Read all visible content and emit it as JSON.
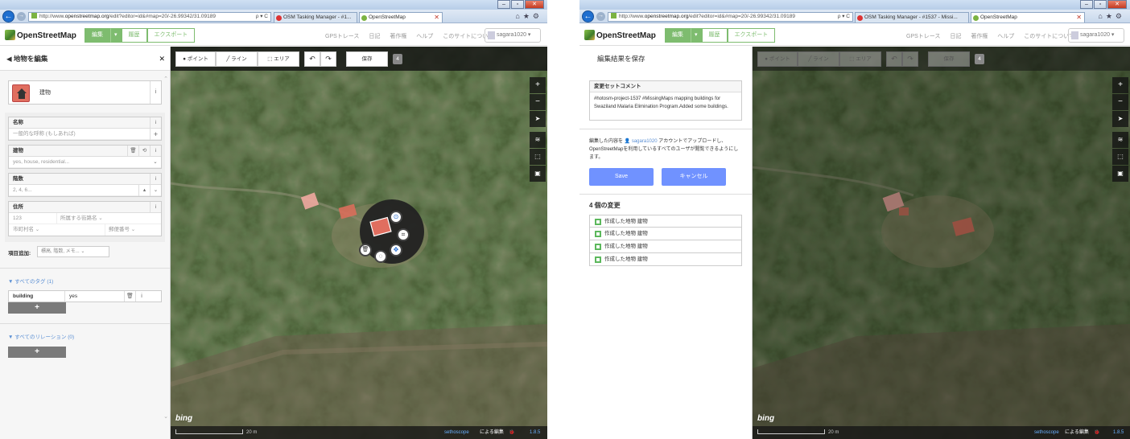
{
  "win1": {
    "address": {
      "pre": "http://www.",
      "host": "openstreetmap.org",
      "post": "/edit?editor=id&#map=20/-26.99342/31.09189",
      "tools": "ρ ▾ C"
    },
    "tabs": [
      {
        "label": "OSM Tasking Manager - #1...",
        "active": false
      },
      {
        "label": "OpenStreetMap",
        "active": true
      }
    ],
    "nav": {
      "logo": "OpenStreetMap",
      "edit": "編集",
      "dd": "▾",
      "history": "履歴",
      "export": "エクスポート",
      "links": [
        "GPSトレース",
        "日記",
        "著作権",
        "ヘルプ",
        "このサイトについて"
      ],
      "user": "sagara1020 ▾"
    },
    "sidebar": {
      "title": "◀  地物を編集",
      "close": "✕",
      "preset": {
        "name": "建物",
        "info": "i"
      },
      "fields": [
        {
          "label": "名称",
          "value": "一般的な呼称 (もしあれば)",
          "icons": [
            "i"
          ],
          "extra": "+"
        },
        {
          "label": "建物",
          "value": "yes, house, residential...",
          "icons": [
            "🗑",
            "⟲",
            "i"
          ],
          "extra": "⌄"
        },
        {
          "label": "階数",
          "value": "2, 4, 6...",
          "icons": [
            "i"
          ],
          "extra": "⌄"
        },
        {
          "label": "住所",
          "icons": [
            "i"
          ],
          "rows": [
            [
              "123",
              "所属する街路名 ⌄"
            ],
            [
              "市町村名 ⌄",
              "郵便番号 ⌄"
            ]
          ]
        }
      ],
      "addfield_label": "項目追加:",
      "addfield_value": "標高, 階数, メモ...",
      "alltags": "▼ すべてのタグ (1)",
      "tag": {
        "key": "building",
        "value": "yes"
      },
      "plus": "+",
      "relations": "▼ すべてのリレーション (0)"
    },
    "toolbar": {
      "point": "ポイント",
      "line": "ライン",
      "area": "エリア",
      "undo": "↶",
      "redo": "↷",
      "save": "保存",
      "count": "4"
    },
    "controls": [
      "+",
      "−",
      "➤",
      "≋",
      "⬚",
      "▣"
    ],
    "attribution": {
      "bing": "bing",
      "scale": "20 m",
      "sethoscope": "sethoscope",
      "edited_by": "による編集",
      "version": "1.8.5"
    }
  },
  "win2": {
    "address": {
      "pre": "http://www.",
      "host": "openstreetmap.org",
      "post": "/edit?editor=id&#map=20/-26.99342/31.09189",
      "tools": "ρ ▾ C"
    },
    "tabs": [
      {
        "label": "OSM Tasking Manager - #1537 - Missi...",
        "active": false
      },
      {
        "label": "OpenStreetMap",
        "active": true
      }
    ],
    "nav": {
      "logo": "OpenStreetMap",
      "edit": "編集",
      "dd": "▾",
      "history": "履歴",
      "export": "エクスポート",
      "links": [
        "GPSトレース",
        "日記",
        "著作権",
        "ヘルプ",
        "このサイトについて"
      ],
      "user": "sagara1020 ▾"
    },
    "sidebar": {
      "title": "編集結果を保存",
      "comment_label": "変更セットコメント",
      "comment": "#hotosm-project-1537 #MissingMaps mapping buildings for Swaziland Malaria Elimination Program.Added some buildings.",
      "upload_pre": "編集した内容を",
      "upload_user": "sagara1020",
      "upload_post": "アカウントでアップロードし、OpenStreetMapを利用しているすべてのユーザが閲覧できるようにします。",
      "save": "Save",
      "cancel": "キャンセル",
      "changes_title": "4 個の変更",
      "changes": [
        "作成した地物 建物",
        "作成した地物 建物",
        "作成した地物 建物",
        "作成した地物 建物"
      ]
    },
    "toolbar": {
      "point": "ポイント",
      "line": "ライン",
      "area": "エリア",
      "undo": "↶",
      "redo": "↷",
      "save": "保存",
      "count": "4"
    },
    "controls": [
      "+",
      "−",
      "➤",
      "≋",
      "⬚",
      "▣"
    ],
    "attribution": {
      "bing": "bing",
      "scale": "20 m",
      "sethoscope": "sethoscope",
      "edited_by": "による編集",
      "version": "1.8.5"
    }
  },
  "colors": {
    "osm_green": "#7ebc6f",
    "button_blue": "#7092ff",
    "selected_red": "#e06e5f"
  }
}
